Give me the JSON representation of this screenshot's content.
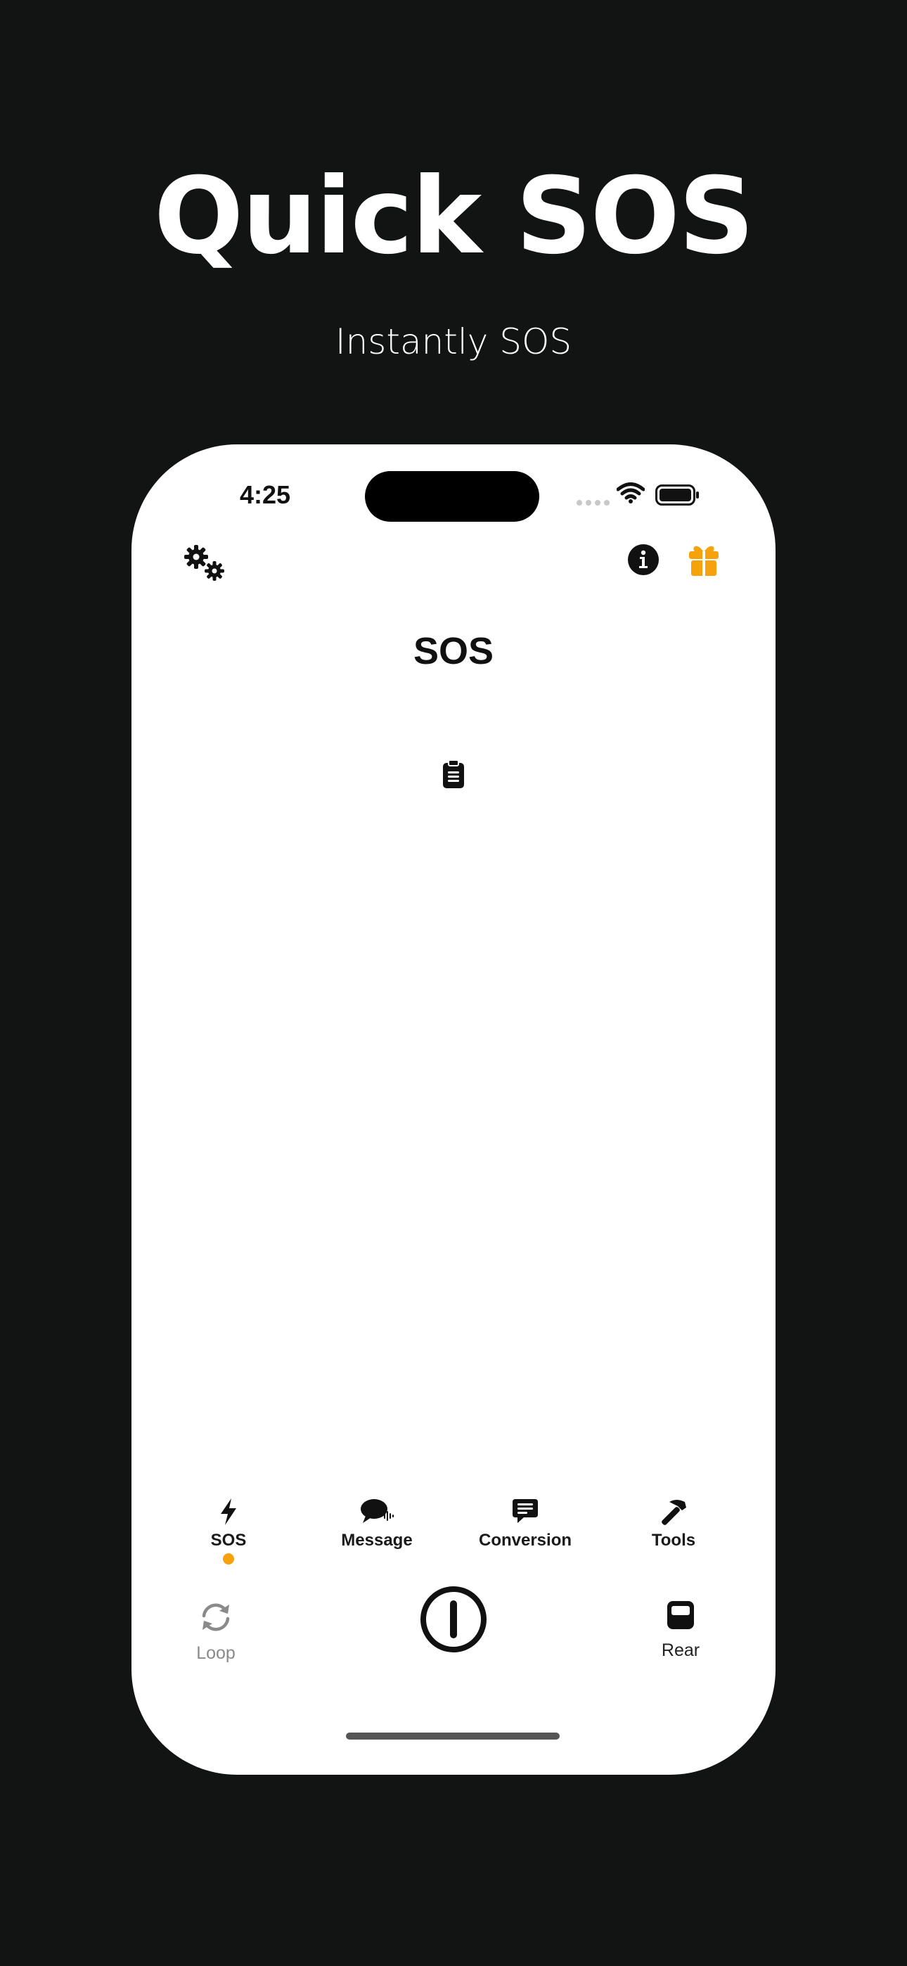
{
  "hero": {
    "title": "Quick SOS",
    "subtitle": "Instantly SOS"
  },
  "status_bar": {
    "time": "4:25",
    "icons": [
      "wifi-icon",
      "battery-icon"
    ]
  },
  "toolbar": {
    "left_icon": "gears-icon",
    "right_icons": [
      "info-icon",
      "gift-icon"
    ]
  },
  "screen": {
    "title": "SOS",
    "center_icon": "clipboard-icon"
  },
  "tabs": [
    {
      "label": "SOS",
      "icon": "bolt-icon",
      "selected": true
    },
    {
      "label": "Message",
      "icon": "speech-bubble-icon",
      "selected": false
    },
    {
      "label": "Conversion",
      "icon": "chat-text-icon",
      "selected": false
    },
    {
      "label": "Tools",
      "icon": "hammer-icon",
      "selected": false
    }
  ],
  "controls": {
    "loop_label": "Loop",
    "power_icon": "power-icon",
    "rear_label": "Rear"
  },
  "colors": {
    "background": "#121313",
    "accent": "#F5A20C",
    "phone_screen": "#FFFFFF",
    "text_dark": "#111111"
  }
}
